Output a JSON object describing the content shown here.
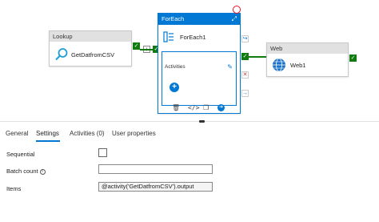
{
  "pipeline": {
    "lookup": {
      "type": "Lookup",
      "name": "GetDatfromCSV",
      "icon": "lookup-search-icon"
    },
    "foreach": {
      "type": "ForEach",
      "name": "ForEach1",
      "inner_label": "Activities",
      "icons": [
        "expand-icon",
        "foreach-icon",
        "edit-pencil-icon",
        "add-activity-icon"
      ]
    },
    "web": {
      "type": "Web",
      "name": "Web1",
      "icon": "globe-icon"
    },
    "actions": [
      "delete-icon",
      "code-icon",
      "copy-icon",
      "go-icon"
    ]
  },
  "panel": {
    "tabs": [
      {
        "label": "General"
      },
      {
        "label": "Settings"
      },
      {
        "label": "Activities (0)"
      },
      {
        "label": "User properties"
      }
    ],
    "active_tab": "Settings",
    "settings": {
      "sequential_label": "Sequential",
      "batch_count_label": "Batch count",
      "items_label": "Items",
      "items_value": "@activity('GetDatfromCSV').output",
      "batch_count_value": ""
    }
  },
  "colors": {
    "accent": "#0078d4",
    "success": "#107c10",
    "error": "#d13438"
  }
}
